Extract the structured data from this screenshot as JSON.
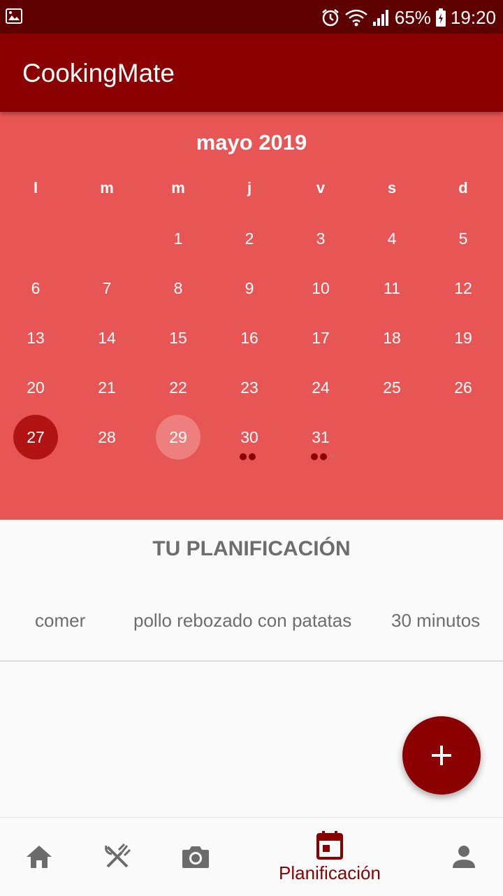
{
  "status_bar": {
    "battery": "65%",
    "time": "19:20",
    "icons": [
      "image-icon",
      "alarm-icon",
      "wifi-icon",
      "signal-icon",
      "battery-icon"
    ]
  },
  "app_bar": {
    "title": "CookingMate"
  },
  "calendar": {
    "month_title": "mayo 2019",
    "weekdays": [
      "l",
      "m",
      "m",
      "j",
      "v",
      "s",
      "d"
    ],
    "weeks": [
      [
        "",
        "",
        "1",
        "2",
        "3",
        "4",
        "5"
      ],
      [
        "6",
        "7",
        "8",
        "9",
        "10",
        "11",
        "12"
      ],
      [
        "13",
        "14",
        "15",
        "16",
        "17",
        "18",
        "19"
      ],
      [
        "20",
        "21",
        "22",
        "23",
        "24",
        "25",
        "26"
      ],
      [
        "27",
        "28",
        "29",
        "30",
        "31",
        "",
        ""
      ]
    ],
    "selected_day": "27",
    "today_day": "29",
    "event_days": {
      "30": 2,
      "31": "2+"
    }
  },
  "planning": {
    "title": "TU PLANIFICACIÓN",
    "entries": [
      {
        "meal": "comer",
        "dish": "pollo rebozado con patatas",
        "duration": "30 minutos"
      }
    ]
  },
  "fab": {
    "icon": "plus-icon",
    "label": "+"
  },
  "bottom_nav": {
    "items": [
      {
        "icon": "home-icon",
        "label": ""
      },
      {
        "icon": "restaurant-icon",
        "label": ""
      },
      {
        "icon": "camera-icon",
        "label": ""
      },
      {
        "icon": "calendar-icon",
        "label": "Planificación",
        "active": true
      },
      {
        "icon": "person-icon",
        "label": ""
      }
    ]
  },
  "colors": {
    "status_bar": "#5e0000",
    "primary": "#8b0000",
    "calendar_bg": "#e85555",
    "selected_day": "#b21414",
    "text_gray": "#6d6d6d",
    "icon_gray": "#6b6b6b"
  }
}
